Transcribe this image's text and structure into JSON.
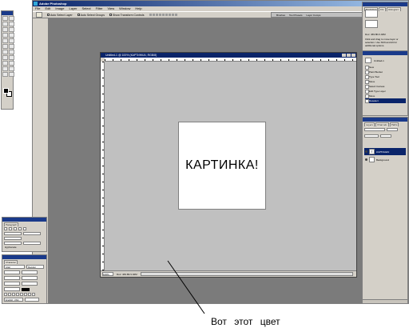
{
  "app": {
    "title": "Adobe Photoshop"
  },
  "menu": {
    "items": [
      "File",
      "Edit",
      "Image",
      "Layer",
      "Select",
      "Filter",
      "View",
      "Window",
      "Help"
    ]
  },
  "options_bar": {
    "auto_select_layer": "Auto Select Layer",
    "auto_select_groups": "Auto Select Groups",
    "show_transform_controls": "Show Transform Controls"
  },
  "palette_well": {
    "tabs": [
      "Brushes",
      "Tool Presets",
      "Layer Comps"
    ]
  },
  "document": {
    "title": "Untitled-1 @ 100% (КАРТИНКА!, RGB/8)",
    "artwork_text": "КАРТИНКА!",
    "zoom": "100%",
    "status": "Doc: 469.8K/1.02M"
  },
  "history": {
    "snapshot": "Untitled-1",
    "items": [
      "New",
      "Paint Bucket",
      "Type Tool",
      "Move",
      "Select Canvas",
      "Edit Type Layer",
      "Move",
      "Deselect"
    ],
    "active_index": 7
  },
  "layers": {
    "tabs": [
      "Layers",
      "Channels",
      "Paths"
    ],
    "rows": [
      {
        "name": "КАРТИНКА!",
        "thumb": "T",
        "selected": true
      },
      {
        "name": "Background",
        "thumb": "",
        "selected": false
      }
    ]
  },
  "navigator": {
    "tabs": [
      "Navigator",
      "Info",
      "Histogram"
    ],
    "hint": "Click and drag to move layer or selection. Use Shift and Alt for additional options."
  },
  "paragraph": {
    "title": "Paragraph",
    "hyphenate": "Hyphenate"
  },
  "character": {
    "title": "Character",
    "font_family": "Arial",
    "font_style": "Regular",
    "language": "English: USA"
  },
  "annotation": {
    "caption": "Вот этот цвет"
  }
}
